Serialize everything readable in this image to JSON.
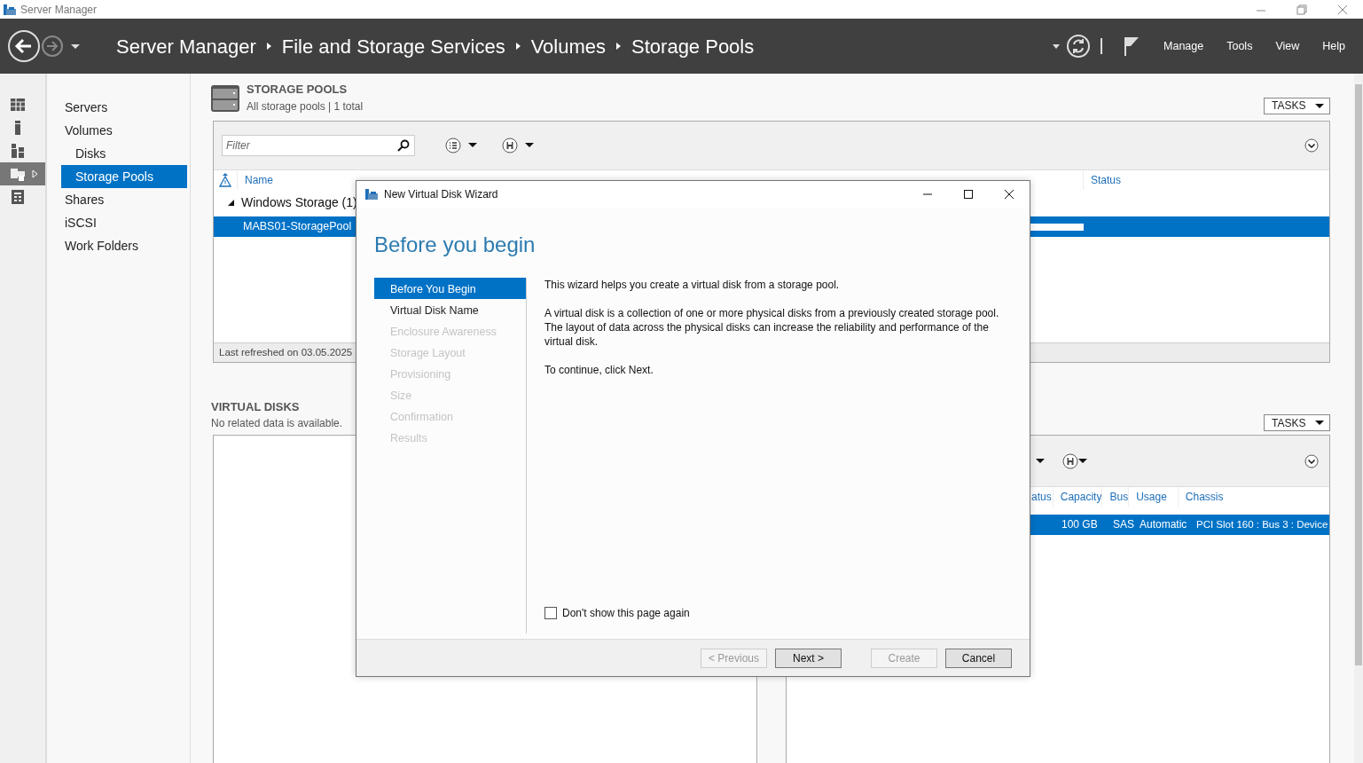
{
  "window": {
    "title": "Server Manager"
  },
  "header": {
    "breadcrumb": [
      "Server Manager",
      "File and Storage Services",
      "Volumes",
      "Storage Pools"
    ],
    "menu": [
      "Manage",
      "Tools",
      "View",
      "Help"
    ]
  },
  "rail": [
    {
      "selected": false
    },
    {
      "selected": false
    },
    {
      "selected": false
    },
    {
      "selected": true
    },
    {
      "selected": false
    }
  ],
  "nav": [
    {
      "label": "Servers",
      "selected": false
    },
    {
      "label": "Volumes",
      "selected": false,
      "children": [
        {
          "label": "Disks",
          "selected": false
        },
        {
          "label": "Storage Pools",
          "selected": true
        }
      ]
    },
    {
      "label": "Shares",
      "selected": false
    },
    {
      "label": "iSCSI",
      "selected": false
    },
    {
      "label": "Work Folders",
      "selected": false
    }
  ],
  "storage_pools": {
    "title": "STORAGE POOLS",
    "subtitle": "All storage pools | 1 total",
    "tasks": "TASKS",
    "filter": {
      "placeholder": "Filter"
    },
    "columns": [
      "Name",
      "Status"
    ],
    "groups": [
      {
        "label": "Windows Storage (1)",
        "expanded": true,
        "rows": [
          {
            "name": "MABS01-StoragePool",
            "selected": true
          }
        ]
      }
    ],
    "footer": "Last refreshed on 03.05.2025"
  },
  "virtual_disks": {
    "title": "VIRTUAL DISKS",
    "subtitle": "No related data is available.",
    "tasks": "TASKS",
    "disk_columns": [
      "atus",
      "Capacity",
      "Bus",
      "Usage",
      "Chassis"
    ],
    "disk_rows": [
      {
        "cells": [
          "100 GB",
          "SAS",
          "Automatic",
          "PCI Slot 160 : Bus 3 : Device"
        ],
        "selected": true
      }
    ]
  },
  "dialog": {
    "title": "New Virtual Disk Wizard",
    "heading": "Before you begin",
    "steps": [
      {
        "label": "Before You Begin",
        "selected": true,
        "disabled": false
      },
      {
        "label": "Virtual Disk Name",
        "selected": false,
        "disabled": false
      },
      {
        "label": "Enclosure Awareness",
        "selected": false,
        "disabled": true
      },
      {
        "label": "Storage Layout",
        "selected": false,
        "disabled": true
      },
      {
        "label": "Provisioning",
        "selected": false,
        "disabled": true
      },
      {
        "label": "Size",
        "selected": false,
        "disabled": true
      },
      {
        "label": "Confirmation",
        "selected": false,
        "disabled": true
      },
      {
        "label": "Results",
        "selected": false,
        "disabled": true
      }
    ],
    "paragraphs": [
      "This wizard helps you create a virtual disk from a storage pool.",
      "A virtual disk is a collection of one or more physical disks from a previously created storage pool. The layout of data across the physical disks can increase the reliability and performance of the virtual disk.",
      "To continue, click Next."
    ],
    "dont_show": {
      "label": "Don't show this page again",
      "checked": false
    },
    "buttons": [
      {
        "label": "< Previous",
        "disabled": true
      },
      {
        "label": "Next >",
        "disabled": false
      },
      {
        "label": "Create",
        "disabled": true
      },
      {
        "label": "Cancel",
        "disabled": false
      }
    ]
  }
}
